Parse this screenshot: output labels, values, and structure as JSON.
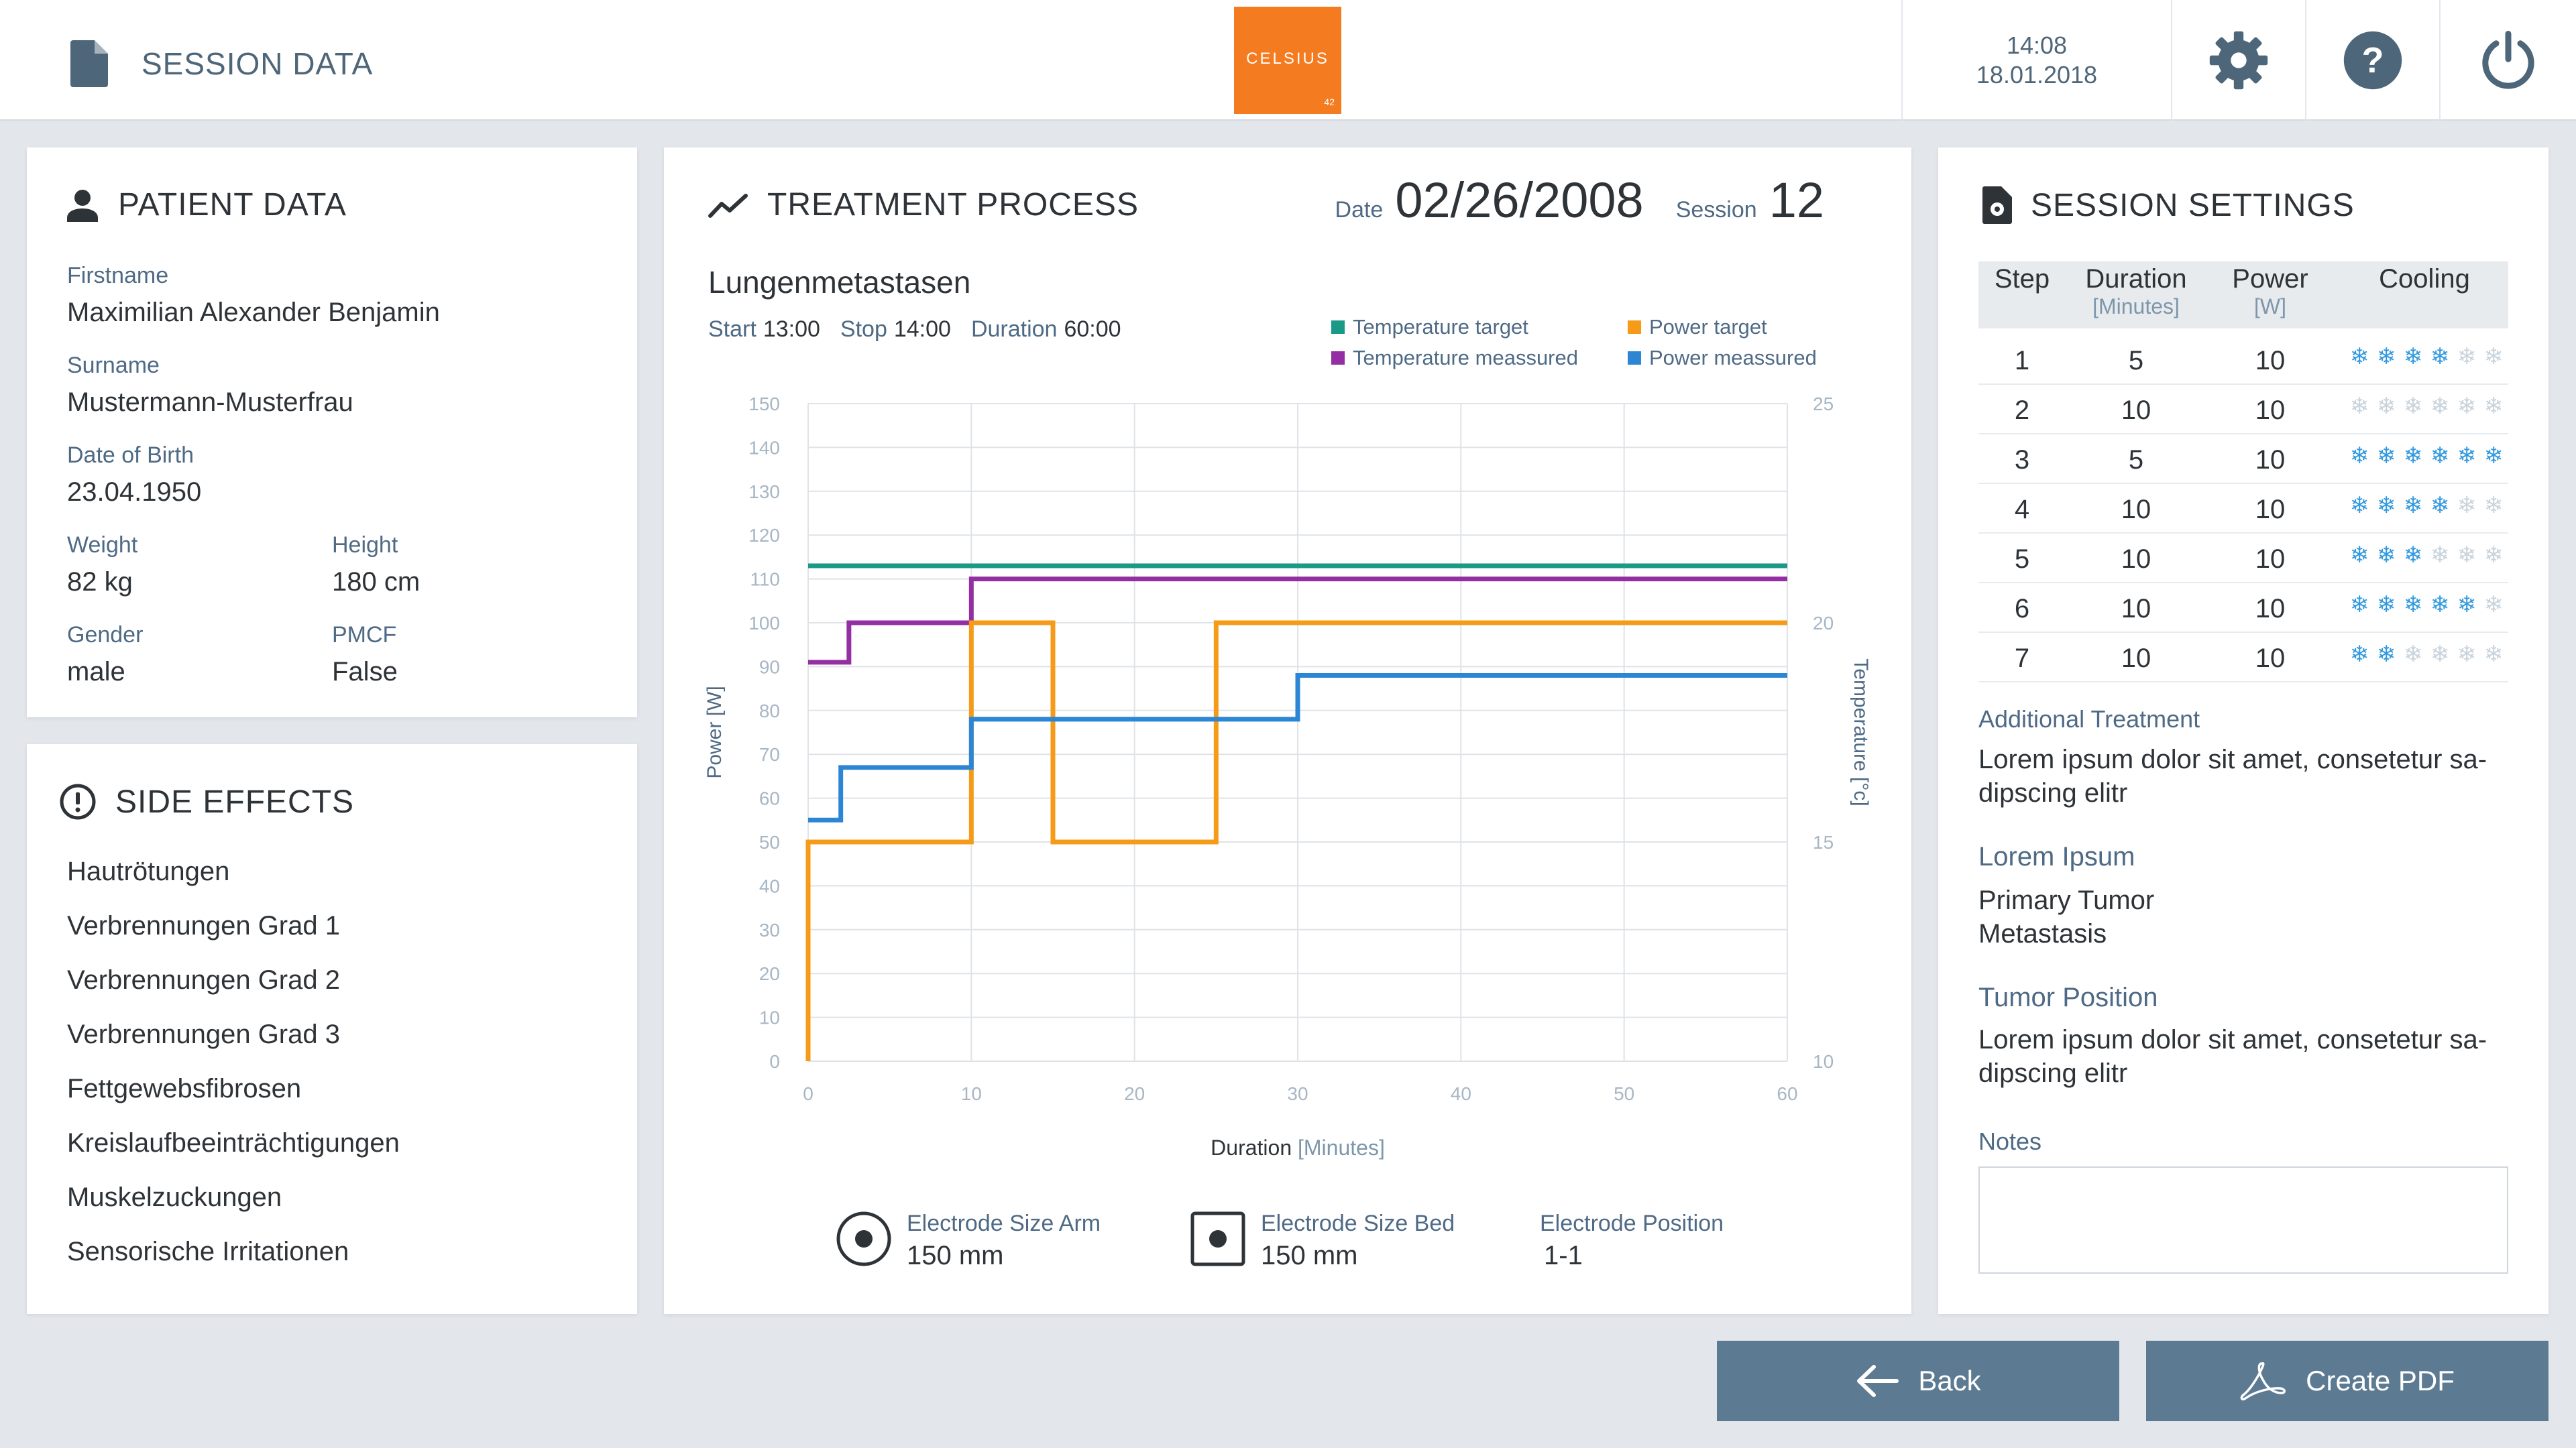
{
  "header": {
    "title": "SESSION DATA",
    "logo_name": "CELSIUS",
    "logo_sub": "42",
    "time": "14:08",
    "date": "18.01.2018"
  },
  "patient": {
    "title": "PATIENT DATA",
    "firstname_label": "Firstname",
    "firstname": "Maximilian Alexander Benjamin",
    "surname_label": "Surname",
    "surname": "Mustermann-Musterfrau",
    "dob_label": "Date of Birth",
    "dob": "23.04.1950",
    "weight_label": "Weight",
    "weight": "82 kg",
    "height_label": "Height",
    "height": "180 cm",
    "gender_label": "Gender",
    "gender": "male",
    "pmcf_label": "PMCF",
    "pmcf": "False"
  },
  "side_effects": {
    "title": "SIDE EFFECTS",
    "items": [
      "Hautrötungen",
      "Verbrennungen Grad 1",
      "Verbrennungen Grad 2",
      "Verbrennungen Grad 3",
      "Fettgewebsfibrosen",
      "Kreislaufbeeinträchtigungen",
      "Muskelzuckungen",
      "Sensorische Irritationen"
    ]
  },
  "treatment": {
    "title": "TREATMENT PROCESS",
    "date_label": "Date",
    "date": "02/26/2008",
    "session_label": "Session",
    "session": "12",
    "name": "Lungenmetastasen",
    "start_label": "Start",
    "start": "13:00",
    "stop_label": "Stop",
    "stop": "14:00",
    "duration_label": "Duration",
    "duration": "60:00",
    "electrode_arm_label": "Electrode Size Arm",
    "electrode_arm": "150 mm",
    "electrode_bed_label": "Electrode Size Bed",
    "electrode_bed": "150 mm",
    "electrode_pos_label": "Electrode Position",
    "electrode_pos": "1-1"
  },
  "chart_data": {
    "type": "line",
    "step": true,
    "xlabel_main": "Duration",
    "xlabel_unit": "[Minutes]",
    "ylabel": "Power [W]",
    "y2label": "Temperature [°c]",
    "xlim": [
      0,
      60
    ],
    "ylim": [
      0,
      150
    ],
    "y2lim": [
      10,
      25
    ],
    "x_ticks": [
      0,
      10,
      20,
      30,
      40,
      50,
      60
    ],
    "y_ticks": [
      0,
      10,
      20,
      30,
      40,
      50,
      60,
      70,
      80,
      90,
      100,
      110,
      120,
      130,
      140,
      150
    ],
    "y2_ticks": [
      10,
      15,
      20,
      25
    ],
    "grid": true,
    "legend_position": "top-right",
    "series": [
      {
        "name": "Temperature target",
        "axis": "y2",
        "color": "#1a9a86",
        "points": [
          [
            0,
            21.3
          ],
          [
            60,
            21.3
          ]
        ]
      },
      {
        "name": "Temperature meassured",
        "axis": "y2",
        "color": "#932fa3",
        "points": [
          [
            0,
            19.1
          ],
          [
            2.5,
            19.1
          ],
          [
            2.5,
            20.0
          ],
          [
            10,
            20.0
          ],
          [
            10,
            21.0
          ],
          [
            60,
            21.0
          ]
        ]
      },
      {
        "name": "Power target",
        "axis": "y",
        "color": "#f59b18",
        "points": [
          [
            0,
            0
          ],
          [
            0,
            50
          ],
          [
            10,
            50
          ],
          [
            10,
            100
          ],
          [
            15,
            100
          ],
          [
            15,
            50
          ],
          [
            25,
            50
          ],
          [
            25,
            100
          ],
          [
            60,
            100
          ]
        ]
      },
      {
        "name": "Power meassured",
        "axis": "y",
        "color": "#2d86d3",
        "points": [
          [
            0,
            55
          ],
          [
            2,
            55
          ],
          [
            2,
            67
          ],
          [
            10,
            67
          ],
          [
            10,
            78
          ],
          [
            30,
            78
          ],
          [
            30,
            88
          ],
          [
            60,
            88
          ]
        ]
      }
    ]
  },
  "settings": {
    "title": "SESSION SETTINGS",
    "col_step": "Step",
    "col_duration": "Duration",
    "col_duration_unit": "[Minutes]",
    "col_power": "Power",
    "col_power_unit": "[W]",
    "col_cooling": "Cooling",
    "rows": [
      {
        "step": "1",
        "duration": "5",
        "power": "10",
        "cooling": 4
      },
      {
        "step": "2",
        "duration": "10",
        "power": "10",
        "cooling": 0
      },
      {
        "step": "3",
        "duration": "5",
        "power": "10",
        "cooling": 6
      },
      {
        "step": "4",
        "duration": "10",
        "power": "10",
        "cooling": 4
      },
      {
        "step": "5",
        "duration": "10",
        "power": "10",
        "cooling": 3
      },
      {
        "step": "6",
        "duration": "10",
        "power": "10",
        "cooling": 5
      },
      {
        "step": "7",
        "duration": "10",
        "power": "10",
        "cooling": 2
      }
    ],
    "cooling_max": 6,
    "additional_label": "Additional Treatment",
    "additional": "Lorem ipsum dolor sit amet, consetetur sa-\ndipscing elitr",
    "lorem_label": "Lorem Ipsum",
    "lorem": "Primary Tumor\nMetastasis",
    "tumor_label": "Tumor Position",
    "tumor": "Lorem ipsum dolor sit amet, consetetur sa-\ndipscing elitr",
    "notes_label": "Notes",
    "notes": ""
  },
  "actions": {
    "back": "Back",
    "pdf": "Create PDF"
  },
  "colors": {
    "accent": "#f47b20",
    "button": "#5c7a91",
    "label": "#4e6a85"
  }
}
